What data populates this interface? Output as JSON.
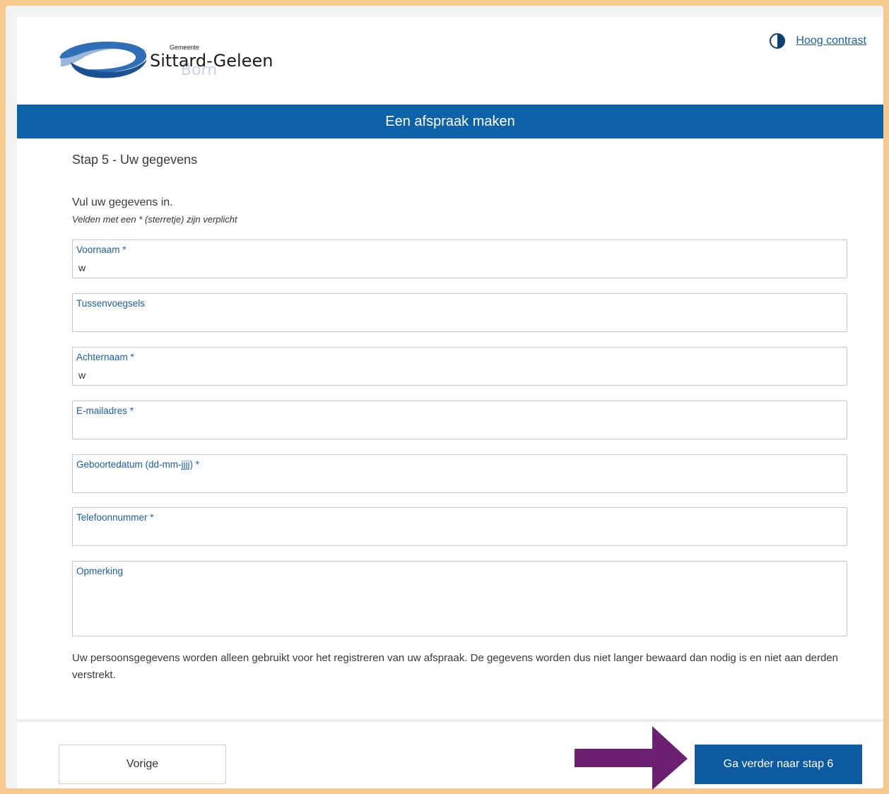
{
  "header": {
    "logo": {
      "small_text": "Gemeente",
      "name": "Sittard-Geleen",
      "subname": "Born"
    },
    "contrast_link": "Hoog contrast",
    "banner_title": "Een afspraak maken"
  },
  "form": {
    "step_title": "Stap 5 - Uw gegevens",
    "intro": "Vul uw gegevens in.",
    "required_note": "Velden met een * (sterretje) zijn verplicht",
    "fields": [
      {
        "label": "Voornaam *",
        "value": "w"
      },
      {
        "label": "Tussenvoegsels",
        "value": ""
      },
      {
        "label": "Achternaam *",
        "value": "w"
      },
      {
        "label": "E-mailadres *",
        "value": ""
      },
      {
        "label": "Geboortedatum (dd-mm-jjjj) *",
        "value": ""
      },
      {
        "label": "Telefoonnummer *",
        "value": ""
      },
      {
        "label": "Opmerking",
        "value": ""
      }
    ],
    "privacy_text": "Uw persoonsgegevens worden alleen gebruikt voor het registreren van uw afspraak. De gegevens worden dus niet langer bewaard dan nodig is en niet aan derden verstrekt."
  },
  "footer": {
    "prev_label": "Vorige",
    "next_label": "Ga verder naar stap 6"
  },
  "colors": {
    "brand_blue": "#0e63a8",
    "label_blue": "#1a5da8",
    "annotation_arrow": "#6b2170",
    "outer_border": "#f8c98f"
  }
}
